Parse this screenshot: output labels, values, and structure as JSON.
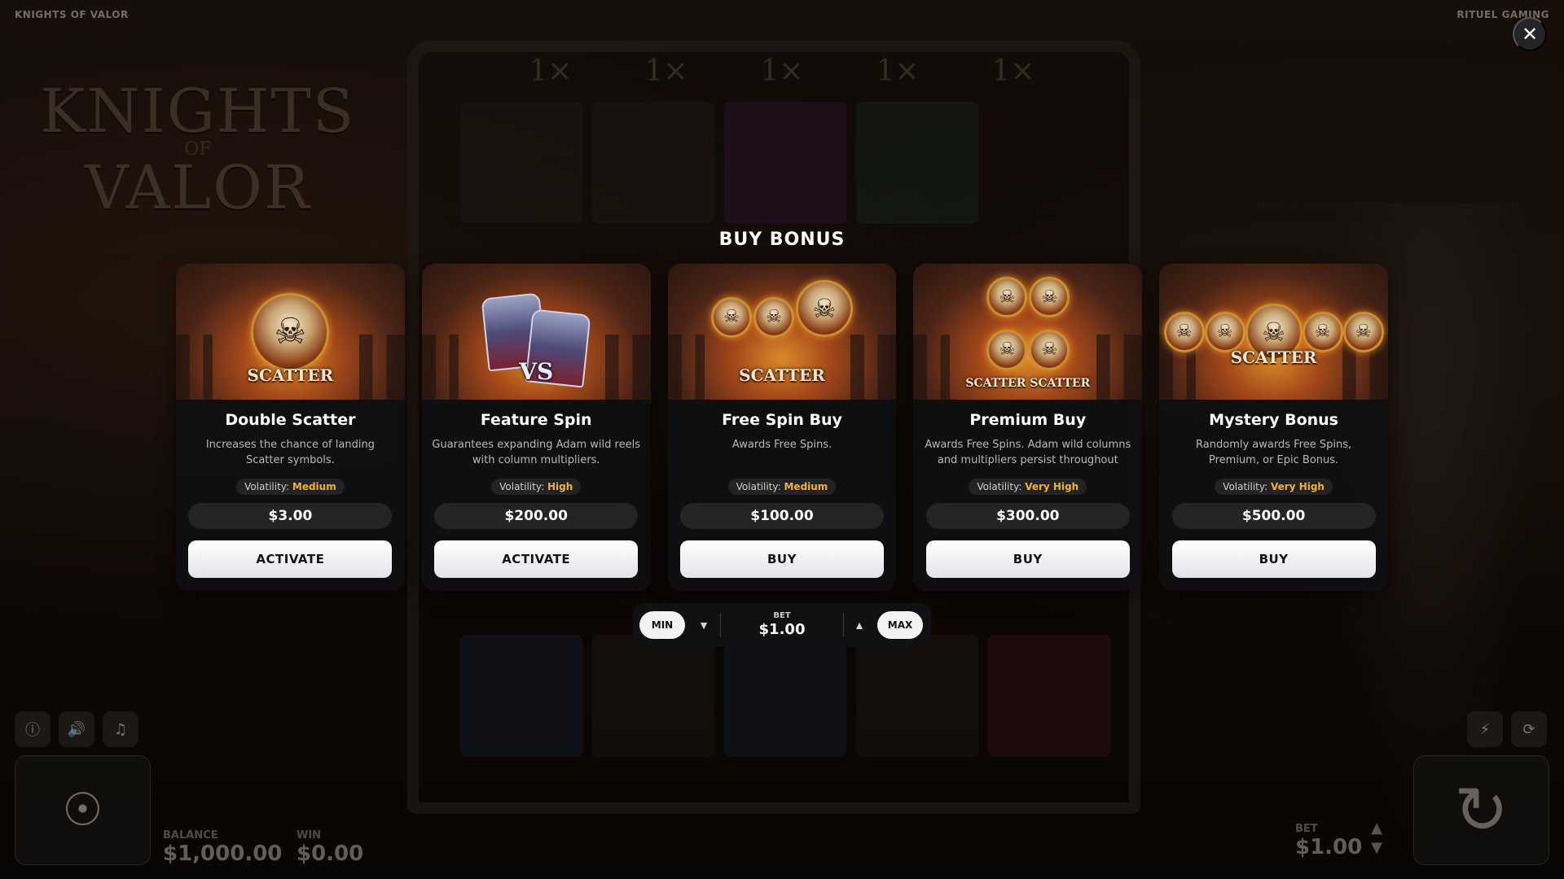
{
  "header": {
    "game_title": "KNIGHTS OF VALOR",
    "studio": "RITUEL GAMING",
    "close_glyph": "✕"
  },
  "background": {
    "logo_top": "KNIGHTS",
    "logo_mid": "OF",
    "logo_bottom": "VALOR",
    "multipliers": [
      "1×",
      "1×",
      "1×",
      "1×",
      "1×"
    ]
  },
  "modal": {
    "title": "BUY BONUS",
    "volatility_label": "Volatility:",
    "accent_color": "#f0b429",
    "cards": [
      {
        "name": "Double Scatter",
        "description": "Increases the chance of landing Scatter symbols.",
        "volatility": "Medium",
        "price": "$3.00",
        "action": "ACTIVATE",
        "art_label": "SCATTER",
        "art": "single-scatter-skull"
      },
      {
        "name": "Feature Spin",
        "description": "Guarantees expanding Adam wild reels with column multipliers.",
        "volatility": "High",
        "price": "$200.00",
        "action": "ACTIVATE",
        "art_label": "VS",
        "art": "knights-vs"
      },
      {
        "name": "Free Spin Buy",
        "description": "Awards Free Spins.",
        "volatility": "Medium",
        "price": "$100.00",
        "action": "BUY",
        "art_label": "SCATTER",
        "art": "triple-scatter-skull"
      },
      {
        "name": "Premium Buy",
        "description": "Awards Free Spins. Adam wild columns and multipliers persist throughout the...",
        "volatility": "Very High",
        "price": "$300.00",
        "action": "BUY",
        "art_label": "SCATTER SCATTER",
        "art": "quad-scatter-skull"
      },
      {
        "name": "Mystery Bonus",
        "description": "Randomly awards Free Spins, Premium, or Epic Bonus.",
        "volatility": "Very High",
        "price": "$500.00",
        "action": "BUY",
        "art_label": "SCATTER",
        "art": "five-scatter-skull"
      }
    ]
  },
  "bet_control": {
    "min_label": "MIN",
    "max_label": "MAX",
    "bet_label": "BET",
    "bet_value": "$1.00",
    "down_icon": "▼",
    "up_icon": "▲"
  },
  "hud": {
    "info_icon": "ⓘ",
    "sound_icon": "🔊",
    "music_icon": "♫",
    "turbo_icon": "⚡",
    "autoplay_icon": "⟳",
    "spin_icon": "↻",
    "balance_label": "BALANCE",
    "balance_value": "$1,000.00",
    "win_label": "WIN",
    "win_value": "$0.00",
    "bet_label": "BET",
    "bet_value": "$1.00",
    "bet_up_icon": "▲",
    "bet_down_icon": "▼"
  }
}
